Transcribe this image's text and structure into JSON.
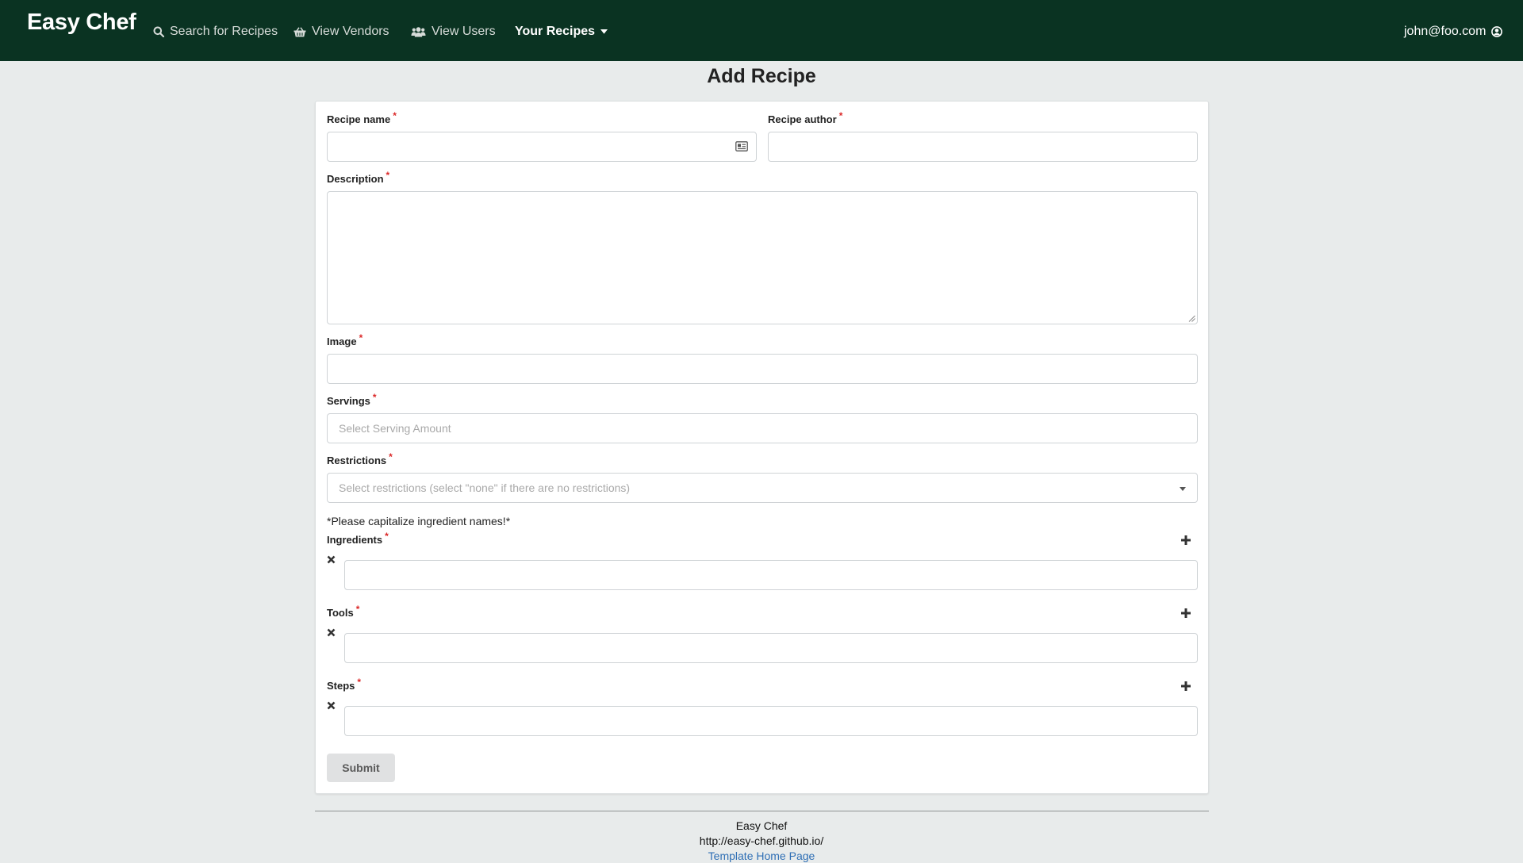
{
  "navbar": {
    "brand": "Easy Chef",
    "items": [
      {
        "label": "Search for Recipes",
        "icon": "search-icon"
      },
      {
        "label": "View Vendors",
        "icon": "basket-icon"
      },
      {
        "label": "View Users",
        "icon": "users-icon"
      },
      {
        "label": "Your Recipes",
        "icon": "caret-down-icon"
      }
    ],
    "user_email": "john@foo.com"
  },
  "page": {
    "title": "Add Recipe"
  },
  "form": {
    "required_marker": "*",
    "recipe_name": {
      "label": "Recipe name",
      "value": "",
      "placeholder": ""
    },
    "recipe_author": {
      "label": "Recipe author",
      "value": "",
      "placeholder": ""
    },
    "description": {
      "label": "Description",
      "value": ""
    },
    "image": {
      "label": "Image",
      "value": ""
    },
    "servings": {
      "label": "Servings",
      "placeholder": "Select Serving Amount"
    },
    "restrictions": {
      "label": "Restrictions",
      "placeholder": "Select restrictions (select \"none\" if there are no restrictions)"
    },
    "ingredient_note": "*Please capitalize ingredient names!*",
    "ingredients": {
      "label": "Ingredients",
      "items": [
        ""
      ]
    },
    "tools": {
      "label": "Tools",
      "items": [
        ""
      ]
    },
    "steps": {
      "label": "Steps",
      "items": [
        ""
      ]
    },
    "submit_label": "Submit"
  },
  "footer": {
    "name": "Easy Chef",
    "url": "http://easy-chef.github.io/",
    "link_label": "Template Home Page"
  },
  "colors": {
    "navbar_bg": "#0a3322",
    "page_bg": "#e8ebeb",
    "required": "#db2828",
    "link": "#2f6fb5"
  }
}
